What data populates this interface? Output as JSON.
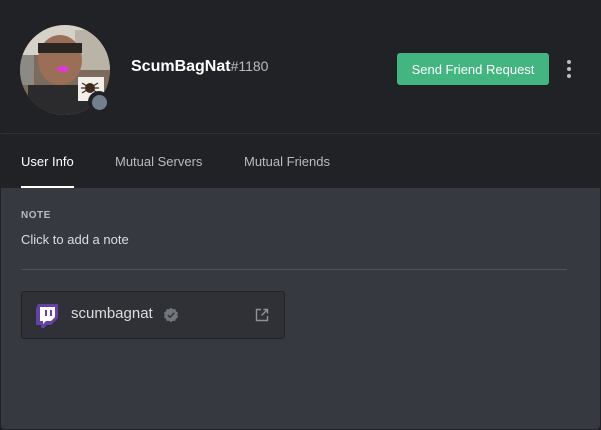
{
  "profile": {
    "username": "ScumBagNat",
    "discriminator": "#1180",
    "status": "offline",
    "status_color": "#747f8d"
  },
  "actions": {
    "send_friend_request_label": "Send Friend Request",
    "friend_button_color": "#43b581",
    "more_icon": "more-vertical-icon"
  },
  "tabs": [
    {
      "label": "User Info",
      "active": true
    },
    {
      "label": "Mutual Servers",
      "active": false
    },
    {
      "label": "Mutual Friends",
      "active": false
    }
  ],
  "note": {
    "label": "NOTE",
    "placeholder": "Click to add a note"
  },
  "connections": [
    {
      "platform": "twitch",
      "platform_icon": "twitch-icon",
      "platform_color": "#6441a5",
      "name": "scumbagnat",
      "verified": true,
      "verified_icon": "verified-icon",
      "link_icon": "external-link-icon"
    }
  ]
}
